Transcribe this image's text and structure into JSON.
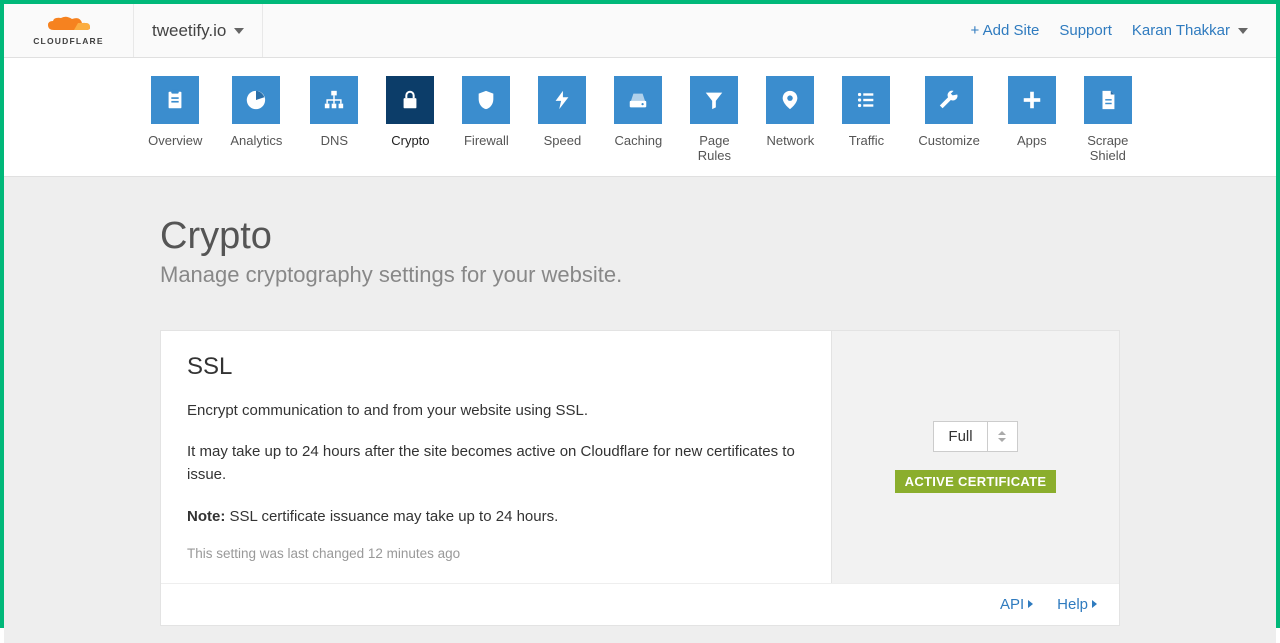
{
  "header": {
    "brand": "CLOUDFLARE",
    "site": "tweetify.io",
    "add_site": "+ Add Site",
    "support": "Support",
    "user": "Karan Thakkar"
  },
  "nav": {
    "items": [
      {
        "label": "Overview",
        "icon": "clipboard"
      },
      {
        "label": "Analytics",
        "icon": "pie"
      },
      {
        "label": "DNS",
        "icon": "sitemap"
      },
      {
        "label": "Crypto",
        "icon": "lock"
      },
      {
        "label": "Firewall",
        "icon": "shield"
      },
      {
        "label": "Speed",
        "icon": "bolt"
      },
      {
        "label": "Caching",
        "icon": "drive"
      },
      {
        "label": "Page Rules",
        "icon": "funnel"
      },
      {
        "label": "Network",
        "icon": "pin"
      },
      {
        "label": "Traffic",
        "icon": "list"
      },
      {
        "label": "Customize",
        "icon": "wrench"
      },
      {
        "label": "Apps",
        "icon": "plus"
      },
      {
        "label": "Scrape Shield",
        "icon": "doc"
      }
    ],
    "active_index": 3
  },
  "page": {
    "title": "Crypto",
    "subtitle": "Manage cryptography settings for your website."
  },
  "ssl": {
    "title": "SSL",
    "desc1": "Encrypt communication to and from your website using SSL.",
    "desc2": "It may take up to 24 hours after the site becomes active on Cloudflare for new certificates to issue.",
    "note_label": "Note:",
    "note_text": " SSL certificate issuance may take up to 24 hours.",
    "meta": "This setting was last changed 12 minutes ago",
    "select_value": "Full",
    "badge": "ACTIVE CERTIFICATE",
    "footer_api": "API",
    "footer_help": "Help"
  }
}
